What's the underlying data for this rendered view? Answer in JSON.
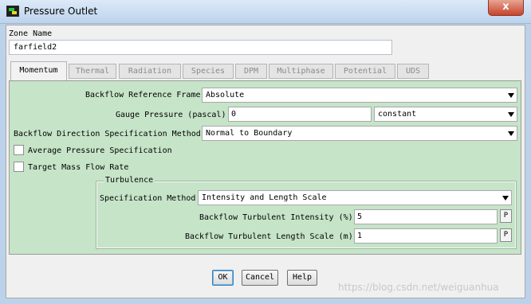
{
  "window": {
    "title": "Pressure Outlet",
    "close_glyph": "x"
  },
  "zone": {
    "label": "Zone Name",
    "value": "farfield2"
  },
  "tabs": [
    {
      "label": "Momentum",
      "active": true
    },
    {
      "label": "Thermal"
    },
    {
      "label": "Radiation"
    },
    {
      "label": "Species"
    },
    {
      "label": "DPM"
    },
    {
      "label": "Multiphase"
    },
    {
      "label": "Potential"
    },
    {
      "label": "UDS"
    }
  ],
  "momentum": {
    "backflow_ref_frame": {
      "label": "Backflow Reference Frame",
      "value": "Absolute"
    },
    "gauge_pressure": {
      "label": "Gauge Pressure (pascal)",
      "value": "0",
      "profile": "constant"
    },
    "backflow_direction": {
      "label": "Backflow Direction Specification Method",
      "value": "Normal to Boundary"
    },
    "avg_pressure": {
      "label": "Average Pressure Specification",
      "checked": false
    },
    "target_mass_flow": {
      "label": "Target Mass Flow Rate",
      "checked": false
    },
    "turbulence": {
      "legend": "Turbulence",
      "spec_method": {
        "label": "Specification Method",
        "value": "Intensity and Length Scale"
      },
      "intensity": {
        "label": "Backflow Turbulent Intensity (%)",
        "value": "5",
        "p_label": "P"
      },
      "length_scale": {
        "label": "Backflow Turbulent Length Scale (m)",
        "value": "1",
        "p_label": "P"
      }
    }
  },
  "buttons": {
    "ok": "OK",
    "cancel": "Cancel",
    "help": "Help"
  },
  "watermark": "https://blog.csdn.net/weiguanhua",
  "colors": {
    "panel_bg": "#c6e4c8",
    "window_frame": "#bcd2ea",
    "close_button": "#c7432a"
  }
}
